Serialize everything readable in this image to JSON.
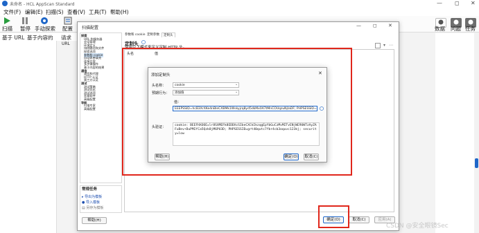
{
  "window": {
    "title": "未命名 - HCL AppScan Standard",
    "controls": [
      "—",
      "◻",
      "✕"
    ]
  },
  "menu": [
    "文件(F)",
    "编辑(E)",
    "扫描(S)",
    "查看(V)",
    "工具(T)",
    "帮助(H)"
  ],
  "toolbar": {
    "left": [
      {
        "label": "扫描",
        "icon": "play-icon"
      },
      {
        "label": "暂停",
        "icon": "pause-icon"
      },
      {
        "label": "手动探索",
        "icon": "explore-icon"
      },
      {
        "label": "配置",
        "icon": "config-icon"
      }
    ],
    "right": [
      {
        "label": "数据",
        "icon": "data-icon"
      },
      {
        "label": "问题",
        "icon": "issues-icon"
      },
      {
        "label": "任务",
        "icon": "tasks-icon"
      }
    ]
  },
  "subtabs": [
    "基于 URL",
    "基于内容的"
  ],
  "left_panel": {
    "header": "请求",
    "url_label": "URL"
  },
  "config_dialog": {
    "title": "扫描配置",
    "tree": [
      {
        "label": "探索",
        "bold": true
      },
      {
        "label": "URL 和服务器",
        "bold": false
      },
      {
        "label": "会话管理",
        "bold": false
      },
      {
        "label": "环境定义",
        "bold": false
      },
      {
        "label": "排除路径和文件",
        "bold": false
      },
      {
        "label": "探索选项",
        "bold": false
      },
      {
        "label": "参数和 cookie",
        "bold": false,
        "selected": true
      },
      {
        "label": "自动表单填充",
        "bold": false
      },
      {
        "label": "连接方案",
        "bold": false
      },
      {
        "label": "多步骤操作",
        "bold": false
      },
      {
        "label": "基于内容的结果",
        "bold": false
      },
      {
        "label": "通信",
        "bold": true
      },
      {
        "label": "通信和代理",
        "bold": false
      },
      {
        "label": "HTTP 认证",
        "bold": false
      },
      {
        "label": "第三方认证",
        "bold": false
      },
      {
        "label": "测试",
        "bold": true
      },
      {
        "label": "测试策略",
        "bold": false
      },
      {
        "label": "测试优化",
        "bold": false
      },
      {
        "label": "测试选项",
        "bold": false
      },
      {
        "label": "恶意软件",
        "bold": false
      },
      {
        "label": "高级配置",
        "bold": false
      },
      {
        "label": "导航",
        "bold": true
      },
      {
        "label": "扫描专家",
        "bold": false
      },
      {
        "label": "高级配置",
        "bold": false
      }
    ],
    "common_tasks": {
      "title": "常规任务",
      "links": [
        "导出为模板",
        "导入模板",
        "另存为模板"
      ]
    },
    "tabs": [
      "参数和 cookie",
      "定制参数",
      "定制头"
    ],
    "section_title": "定制头",
    "section_desc": "使用以下模式来定义定制 HTTP 头。",
    "table_headers": [
      "头名",
      "值"
    ],
    "buttons": {
      "help": "帮助(H)",
      "ok": "确定(O)",
      "cancel": "取消(C)",
      "apply": "应用(A)"
    }
  },
  "header_dialog": {
    "title": "添加定制头",
    "name_label": "头名称：",
    "name_value": "cookie",
    "behavior_label": "预期行为：",
    "behavior_value": "添加值",
    "value_label": "值：",
    "value_text": "EEEPSSID=hcB3XrXKe4nBleCXBMk1Wskyjrq8yd5dkMx0A7tMnCOUqzuNjIaDF; PHPSESSID=grt40qutc7fbr4cb3oquvc123kj; security=low",
    "preview_label": "头验证：",
    "preview_text": "cookie: BEEFHXOOE=lr8SXMEFk8EDDXcSIbeCXCkIkzqgEpYbGuCzMvMITvENjWE9UWTzAyZAFuBev+DuPMIfCa5Qzk8jM6PU3D; PHPSESSID=grt40qutc7fbr4cb3oquvc123kj; security=low",
    "buttons": {
      "help": "帮助(H)",
      "ok": "确定(O)",
      "cancel": "取消(C)"
    }
  },
  "watermark": "CSDN @安全眼镜Sec",
  "colors": {
    "accent": "#1e66c8",
    "highlight": "#e0261b"
  }
}
